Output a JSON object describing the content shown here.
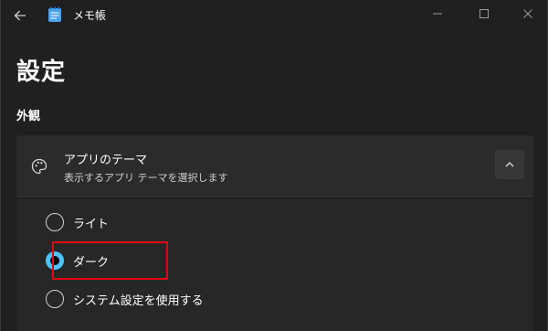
{
  "window": {
    "title": "メモ帳",
    "controls": {
      "minimize_icon": "minimize-icon",
      "maximize_icon": "maximize-icon",
      "close_icon": "close-icon"
    }
  },
  "page": {
    "title": "設定",
    "section_title": "外観"
  },
  "theme_setting": {
    "title": "アプリのテーマ",
    "description": "表示するアプリ テーマを選択します",
    "icon": "palette-icon",
    "expanded": true,
    "options": [
      {
        "label": "ライト",
        "selected": false
      },
      {
        "label": "ダーク",
        "selected": true
      },
      {
        "label": "システム設定を使用する",
        "selected": false
      }
    ]
  },
  "colors": {
    "background": "#202020",
    "card": "#2b2b2b",
    "accent": "#4cc2ff",
    "highlight": "#e60012"
  }
}
